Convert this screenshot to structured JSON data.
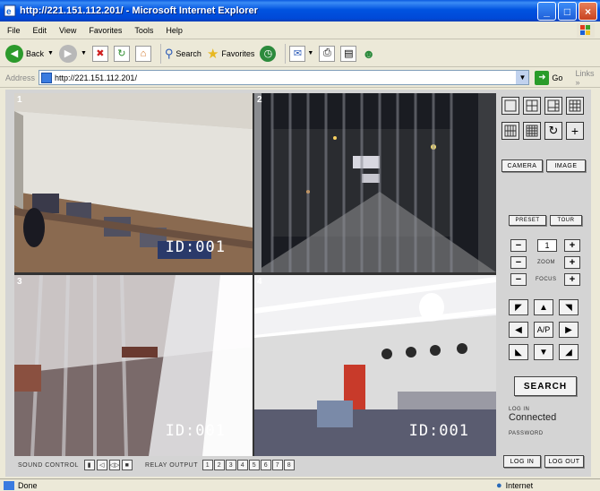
{
  "window": {
    "title": "http://221.151.112.201/ - Microsoft Internet Explorer"
  },
  "menu": [
    "File",
    "Edit",
    "View",
    "Favorites",
    "Tools",
    "Help"
  ],
  "toolbar": {
    "back": "Back",
    "search": "Search",
    "favorites": "Favorites"
  },
  "address": {
    "label": "Address",
    "url": "http://221.151.112.201/",
    "go": "Go",
    "links": "Links",
    "more": "»"
  },
  "cameras": [
    {
      "num": "1",
      "id": "ID:001"
    },
    {
      "num": "2",
      "id": ""
    },
    {
      "num": "3",
      "id": "ID:001"
    },
    {
      "num": "4",
      "id": "ID:001"
    }
  ],
  "panel": {
    "camera_btn": "CAMERA",
    "image_btn": "IMAGE",
    "preset_btn": "PRESET",
    "tour_btn": "TOUR",
    "preset_value": "1",
    "zoom_label": "ZOOM",
    "focus_label": "FOCUS",
    "minus": "−",
    "plus": "+",
    "ap_label": "A/P",
    "search_btn": "SEARCH",
    "login_label": "LOG IN",
    "connected": "Connected",
    "password_label": "PASSWORD",
    "login_btn": "LOG IN",
    "logout_btn": "LOG OUT"
  },
  "bottom": {
    "sound_label": "SOUND CONTROL",
    "relay_label": "RELAY OUTPUT",
    "relays": [
      "1",
      "2",
      "3",
      "4",
      "5",
      "6",
      "7",
      "8"
    ]
  },
  "status": {
    "left": "Done",
    "zone": "Internet"
  }
}
